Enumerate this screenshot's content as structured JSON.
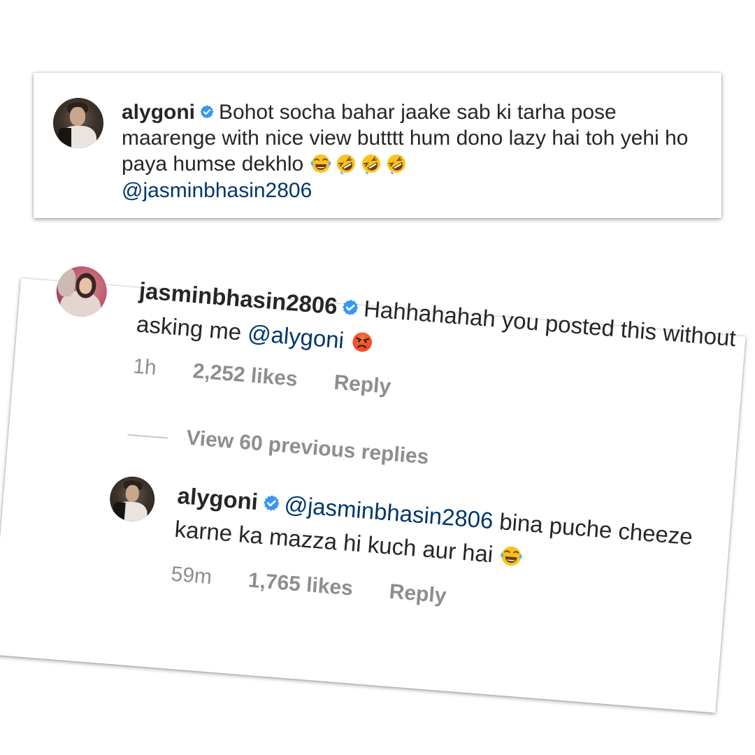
{
  "caption": {
    "username": "alygoni",
    "text": "Bohot socha bahar jaake sab ki tarha pose maarenge with nice view butttt hum dono lazy hai toh yehi ho paya humse dekhlo",
    "emojis": [
      "face-with-tears-of-joy",
      "rolling-on-floor-laughing",
      "rolling-on-floor-laughing",
      "rolling-on-floor-laughing"
    ],
    "mention": "@jasminbhasin2806"
  },
  "comment": {
    "username": "jasminbhasin2806",
    "text": "Hahhahahah you posted this without asking me",
    "mention": "@alygoni",
    "emoji": "pouting-face",
    "time": "1h",
    "likes": "2,252 likes",
    "reply_label": "Reply"
  },
  "view_replies_label": "View 60 previous replies",
  "reply": {
    "username": "alygoni",
    "mention": "@jasminbhasin2806",
    "text": "bina puche cheeze karne ka mazza hi kuch aur hai",
    "emoji": "face-with-tears-of-joy",
    "time": "59m",
    "likes": "1,765 likes",
    "reply_label": "Reply"
  },
  "colors": {
    "text": "#262626",
    "mention": "#00376b",
    "meta": "#8e8e8e",
    "verified": "#3897f0"
  }
}
